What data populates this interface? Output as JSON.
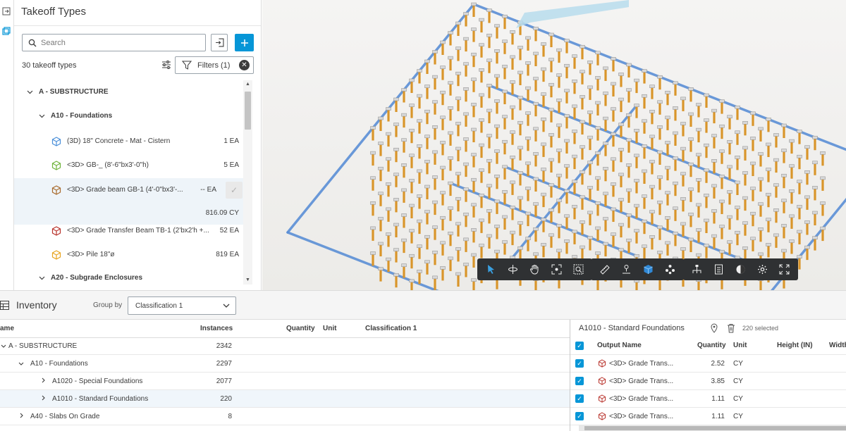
{
  "takeoff": {
    "title": "Takeoff Types",
    "search_placeholder": "Search",
    "count_label": "30 takeoff types",
    "filters_label": "Filters (1)",
    "tree": [
      {
        "kind": "group",
        "label": "A - SUBSTRUCTURE"
      },
      {
        "kind": "subgroup",
        "label": "A10 - Foundations"
      },
      {
        "kind": "item",
        "label": "(3D) 18\" Concrete - Mat - Cistern",
        "qty": "1 EA",
        "cube_color": "#4a8fd9"
      },
      {
        "kind": "item",
        "label": "<3D> GB-_ (8'-6\"bx3'-0\"h)",
        "qty": "5 EA",
        "cube_color": "#6fb33b"
      },
      {
        "kind": "item",
        "label": "<3D> Grade beam GB-1 (4'-0\"bx3'-...",
        "qty": "-- EA",
        "cube_color": "#a86a2c"
      },
      {
        "kind": "value",
        "label": "",
        "qty": "816.09 CY"
      },
      {
        "kind": "item",
        "label": "<3D> Grade Transfer Beam TB-1 (2'bx2'h +...",
        "qty": "52 EA",
        "cube_color": "#b8332c"
      },
      {
        "kind": "item",
        "label": "<3D> Pile 18\"ø",
        "qty": "819 EA",
        "cube_color": "#e8a41f"
      },
      {
        "kind": "subgroup",
        "label": "A20 - Subgrade Enclosures"
      }
    ]
  },
  "inventory": {
    "title": "Inventory",
    "group_by_label": "Group by",
    "group_by_value": "Classification 1",
    "columns": [
      "ame",
      "Instances",
      "Quantity",
      "Unit",
      "Classification 1"
    ],
    "rows": [
      {
        "name": "A - SUBSTRUCTURE",
        "instances": "2342"
      },
      {
        "name": "A10 - Foundations",
        "instances": "2297"
      },
      {
        "name": "A1020 - Special Foundations",
        "instances": "2077"
      },
      {
        "name": "A1010 - Standard Foundations",
        "instances": "220"
      },
      {
        "name": "A40 - Slabs On Grade",
        "instances": "8"
      }
    ]
  },
  "output": {
    "title": "A1010 - Standard Foundations",
    "selected_label": "220 selected",
    "columns": [
      "Output Name",
      "Quantity",
      "Unit",
      "Height (IN)",
      "Width"
    ],
    "rows": [
      {
        "name": "<3D> Grade Trans...",
        "qty": "2.52",
        "unit": "CY"
      },
      {
        "name": "<3D> Grade Trans...",
        "qty": "3.85",
        "unit": "CY"
      },
      {
        "name": "<3D> Grade Trans...",
        "qty": "1.11",
        "unit": "CY"
      },
      {
        "name": "<3D> Grade Trans...",
        "qty": "1.11",
        "unit": "CY"
      }
    ]
  },
  "viewer_toolbar": {
    "groups": [
      [
        "select-icon",
        "orbit-icon",
        "pan-icon",
        "fit-icon",
        "zoom-window-icon"
      ],
      [
        "measure-icon",
        "section-icon",
        "cube-icon",
        "explode-icon"
      ],
      [
        "model-tree-icon",
        "properties-icon",
        "render-icon",
        "settings-icon",
        "fullscreen-icon"
      ]
    ]
  },
  "colors": {
    "accent": "#0696d7",
    "toolbar_bg": "#2f3133",
    "pile": "#d9952a",
    "beam": "#5b8fd6"
  }
}
